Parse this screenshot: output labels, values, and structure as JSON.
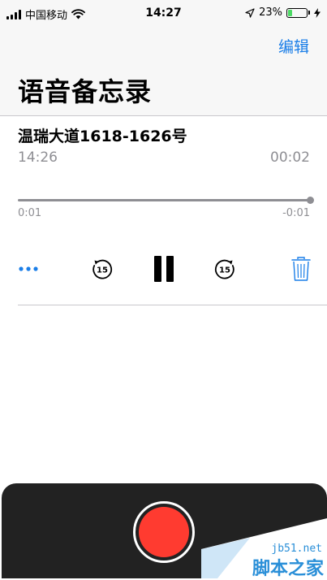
{
  "status_bar": {
    "carrier": "中国移动",
    "time": "14:27",
    "battery_percent": "23%",
    "battery_level": 0.23,
    "icons": [
      "signal-icon",
      "wifi-icon",
      "location-icon",
      "battery-icon",
      "charging-icon"
    ]
  },
  "nav": {
    "edit_label": "编辑",
    "title": "语音备忘录"
  },
  "memo": {
    "title": "温瑞大道1618-1626号",
    "recorded_time": "14:26",
    "duration": "00:02",
    "elapsed": "0:01",
    "remaining": "-0:01",
    "progress": 1.0
  },
  "controls": {
    "icons": [
      "more-icon",
      "skip-back-15-icon",
      "pause-icon",
      "skip-forward-15-icon",
      "trash-icon"
    ],
    "skip_seconds": "15"
  },
  "record": {
    "icon": "record-icon"
  },
  "watermark": {
    "site": "jb51.net",
    "text": "脚本之家"
  },
  "colors": {
    "accent": "#1a7ee8",
    "record_red": "#ff3b30",
    "secondary_text": "#8e8e93",
    "panel_dark": "#222222"
  }
}
